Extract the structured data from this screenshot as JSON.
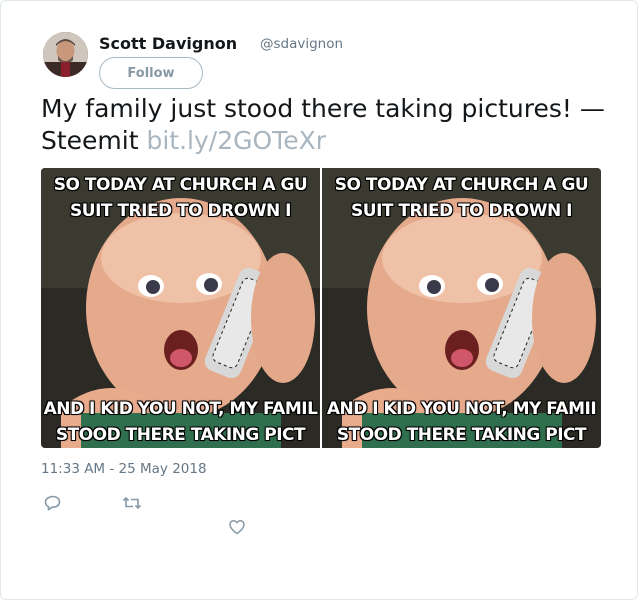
{
  "author": {
    "name": "Scott Davignon",
    "handle": "@sdavignon",
    "avatar_icon": "person-avatar"
  },
  "follow_label": "Follow",
  "tweet": {
    "text": "My family just stood there taking pictures! — Steemit ",
    "link": "bit.ly/2GOTeXr"
  },
  "media": [
    {
      "top_line1": "SO TODAY AT CHURCH A GU",
      "top_line2": "SUIT TRIED TO DROWN I",
      "bottom_line1": "AND I KID YOU NOT, MY FAMIL",
      "bottom_line2": "STOOD THERE TAKING PICT"
    },
    {
      "top_line1": "SO TODAY AT CHURCH A GU",
      "top_line2": "SUIT TRIED TO DROWN I",
      "bottom_line1": "AND I KID YOU NOT, MY FAMII",
      "bottom_line2": "STOOD THERE TAKING PICT"
    }
  ],
  "timestamp": "11:33 AM - 25 May 2018",
  "actions": {
    "reply_icon": "reply-icon",
    "retweet_icon": "retweet-icon",
    "like_icon": "heart-icon"
  },
  "colors": {
    "text": "#14171a",
    "muted": "#657786",
    "link": "#a9b6c0",
    "border": "#e1e8ed"
  }
}
